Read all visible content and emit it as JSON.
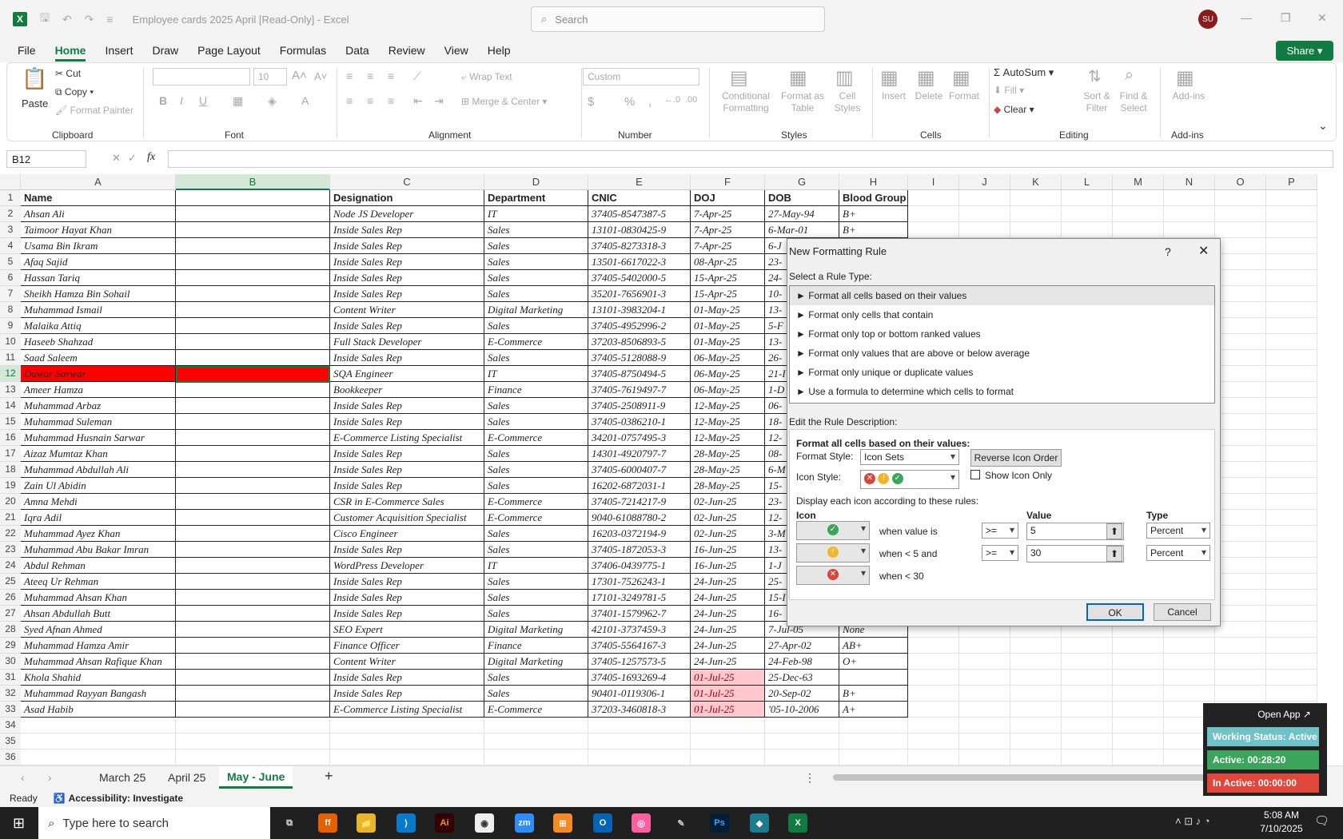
{
  "title": "Employee cards 2025 April  [Read-Only]  -  Excel",
  "search_placeholder": "Search",
  "user_initials": "SU",
  "menu": [
    "File",
    "Home",
    "Insert",
    "Draw",
    "Page Layout",
    "Formulas",
    "Data",
    "Review",
    "View",
    "Help"
  ],
  "share": "Share",
  "ribbon": {
    "clipboard": {
      "label": "Clipboard",
      "paste": "Paste",
      "cut": "Cut",
      "copy": "Copy",
      "painter": "Format Painter"
    },
    "font": {
      "label": "Font",
      "size": "10"
    },
    "alignment": {
      "label": "Alignment",
      "wrap": "Wrap Text",
      "merge": "Merge & Center"
    },
    "number": {
      "label": "Number",
      "format": "Custom"
    },
    "styles": {
      "label": "Styles",
      "cond": "Conditional\nFormatting",
      "table": "Format as\nTable",
      "cell": "Cell\nStyles"
    },
    "cells": {
      "label": "Cells",
      "insert": "Insert",
      "delete": "Delete",
      "format": "Format"
    },
    "editing": {
      "label": "Editing",
      "autosum": "AutoSum",
      "fill": "Fill",
      "clear": "Clear",
      "sort": "Sort &\nFilter",
      "find": "Find &\nSelect"
    },
    "addins": {
      "label": "Add-ins",
      "addins": "Add-ins"
    }
  },
  "namebox": "B12",
  "columns": [
    "A",
    "B",
    "C",
    "D",
    "E",
    "F",
    "G",
    "H",
    "I",
    "J",
    "K",
    "L",
    "M",
    "N",
    "O",
    "P"
  ],
  "headers": [
    "Name",
    "",
    "Designation",
    "Department",
    "CNIC",
    "DOJ",
    "DOB",
    "Blood Group"
  ],
  "rows": [
    [
      "Ahsan Ali",
      "",
      "Node JS Developer",
      "IT",
      "37405-8547387-5",
      "7-Apr-25",
      "27-May-94",
      "B+"
    ],
    [
      "Taimoor Hayat Khan",
      "",
      "Inside Sales Rep",
      "Sales",
      "13101-0830425-9",
      "7-Apr-25",
      "6-Mar-01",
      "B+"
    ],
    [
      "Usama Bin Ikram",
      "",
      "Inside Sales Rep",
      "Sales",
      "37405-8273318-3",
      "7-Apr-25",
      "6-J",
      ""
    ],
    [
      "Afaq Sajid",
      "",
      "Inside Sales Rep",
      "Sales",
      "13501-6617022-3",
      "08-Apr-25",
      "23-",
      ""
    ],
    [
      "Hassan Tariq",
      "",
      "Inside Sales Rep",
      "Sales",
      "37405-5402000-5",
      "15-Apr-25",
      "24-",
      ""
    ],
    [
      "Sheikh Hamza Bin Sohail",
      "",
      "Inside Sales Rep",
      "Sales",
      "35201-7656901-3",
      "15-Apr-25",
      "10-",
      ""
    ],
    [
      "Muhammad Ismail",
      "",
      "Content Writer",
      "Digital Marketing",
      "13101-3983204-1",
      "01-May-25",
      "13-",
      ""
    ],
    [
      "Malaika Attiq",
      "",
      "Inside Sales Rep",
      "Sales",
      "37405-4952996-2",
      "01-May-25",
      "5-F",
      ""
    ],
    [
      "Haseeb Shahzad",
      "",
      "Full Stack Developer",
      "E-Commerce",
      "37203-8506893-5",
      "01-May-25",
      "13-",
      ""
    ],
    [
      "Saad Saleem",
      "",
      "Inside Sales Rep",
      "Sales",
      "37405-5128088-9",
      "06-May-25",
      "26-",
      ""
    ],
    [
      "Dawar Sarwar",
      "",
      "SQA Engineer",
      "IT",
      "37405-8750494-5",
      "06-May-25",
      "21-I",
      ""
    ],
    [
      "Ameer Hamza",
      "",
      "Bookkeeper",
      "Finance",
      "37405-7619497-7",
      "06-May-25",
      "1-D",
      ""
    ],
    [
      "Muhammad Arbaz",
      "",
      "Inside Sales Rep",
      "Sales",
      "37405-2508911-9",
      "12-May-25",
      "06-",
      ""
    ],
    [
      "Muhammad Suleman",
      "",
      "Inside Sales Rep",
      "Sales",
      "37405-0386210-1",
      "12-May-25",
      "18-",
      ""
    ],
    [
      "Muhammad Husnain Sarwar",
      "",
      "E-Commerce Listing Specialist",
      "E-Commerce",
      "34201-0757495-3",
      "12-May-25",
      "12-",
      ""
    ],
    [
      "Aizaz Mumtaz Khan",
      "",
      "Inside Sales Rep",
      "Sales",
      "14301-4920797-7",
      "28-May-25",
      "08-",
      ""
    ],
    [
      "Muhammad Abdullah Ali",
      "",
      "Inside Sales Rep",
      "Sales",
      "37405-6000407-7",
      "28-May-25",
      "6-M",
      ""
    ],
    [
      "Zain Ul Abidin",
      "",
      "Inside Sales Rep",
      "Sales",
      "16202-6872031-1",
      "28-May-25",
      "15-",
      ""
    ],
    [
      "Amna Mehdi",
      "",
      "CSR in E-Commerce Sales",
      "E-Commerce",
      "37405-7214217-9",
      "02-Jun-25",
      "23-",
      ""
    ],
    [
      "Iqra Adil",
      "",
      "Customer Acquisition Specialist",
      "E-Commerce",
      "9040-61088780-2",
      "02-Jun-25",
      "12-",
      ""
    ],
    [
      "Muhammad Ayez Khan",
      "",
      "Cisco Engineer",
      "Sales",
      "16203-0372194-9",
      "02-Jun-25",
      "3-M",
      ""
    ],
    [
      "Muhammad Abu Bakar Imran",
      "",
      "Inside Sales Rep",
      "Sales",
      "37405-1872053-3",
      "16-Jun-25",
      "13-",
      ""
    ],
    [
      "Abdul Rehman",
      "",
      "WordPress Developer",
      "IT",
      "37406-0439775-1",
      "16-Jun-25",
      "1-J",
      ""
    ],
    [
      "Ateeq Ur Rehman",
      "",
      "Inside Sales Rep",
      "Sales",
      "17301-7526243-1",
      "24-Jun-25",
      "25-",
      ""
    ],
    [
      "Muhammad Ahsan Khan",
      "",
      "Inside Sales Rep",
      "Sales",
      "17101-3249781-5",
      "24-Jun-25",
      "15-I",
      ""
    ],
    [
      "Ahsan Abdullah Butt",
      "",
      "Inside Sales Rep",
      "Sales",
      "37401-1579962-7",
      "24-Jun-25",
      "16-",
      ""
    ],
    [
      "Syed Afnan Ahmed",
      "",
      "SEO Expert",
      "Digital Marketing",
      "42101-3737459-3",
      "24-Jun-25",
      "7-Jul-05",
      "None"
    ],
    [
      "Muhammad Hamza Amir",
      "",
      "Finance Officer",
      "Finance",
      "37405-5564167-3",
      "24-Jun-25",
      "27-Apr-02",
      "AB+"
    ],
    [
      "Muhammad Ahsan Rafique Khan",
      "",
      "Content Writer",
      "Digital Marketing",
      "37405-1257573-5",
      "24-Jun-25",
      "24-Feb-98",
      "O+"
    ],
    [
      "Khola Shahid",
      "",
      "Inside Sales Rep",
      "Sales",
      "37405-1693269-4",
      "01-Jul-25",
      "25-Dec-63",
      ""
    ],
    [
      "Muhammad Rayyan Bangash",
      "",
      "Inside Sales Rep",
      "Sales",
      "90401-0119306-1",
      "01-Jul-25",
      "20-Sep-02",
      "B+"
    ],
    [
      "Asad Habib",
      "",
      "E-Commerce Listing Specialist",
      "E-Commerce",
      "37203-3460818-3",
      "01-Jul-25",
      "'05-10-2006",
      "A+"
    ]
  ],
  "sheets": [
    "March 25",
    "April 25",
    "May - June"
  ],
  "status": {
    "ready": "Ready",
    "accessibility": "Accessibility: Investigate"
  },
  "taskbar": {
    "search": "Type here to search",
    "time": "5:08 AM",
    "date": "7/10/2025"
  },
  "dialog": {
    "title": "New Formatting Rule",
    "help": "?",
    "select_label": "Select a Rule Type:",
    "rule_types": [
      "► Format all cells based on their values",
      "► Format only cells that contain",
      "► Format only top or bottom ranked values",
      "► Format only values that are above or below average",
      "► Format only unique or duplicate values",
      "► Use a formula to determine which cells to format"
    ],
    "edit_label": "Edit the Rule Description:",
    "desc_heading": "Format all cells based on their values:",
    "format_style_label": "Format Style:",
    "format_style": "Icon Sets",
    "reverse": "Reverse Icon Order",
    "icon_style_label": "Icon Style:",
    "show_icon_only": "Show Icon Only",
    "display_rule": "Display each icon according to these rules:",
    "col_icon": "Icon",
    "col_value": "Value",
    "col_type": "Type",
    "rules": [
      {
        "text": "when value is",
        "op": ">=",
        "value": "5",
        "type": "Percent"
      },
      {
        "text": "when < 5 and",
        "op": ">=",
        "value": "30",
        "type": "Percent"
      },
      {
        "text": "when < 30"
      }
    ],
    "ok": "OK",
    "cancel": "Cancel"
  },
  "widget": {
    "open": "Open App ↗",
    "status": "Working Status: Active",
    "active": "Active: 00:28:20",
    "inactive": "In Active: 00:00:00"
  }
}
